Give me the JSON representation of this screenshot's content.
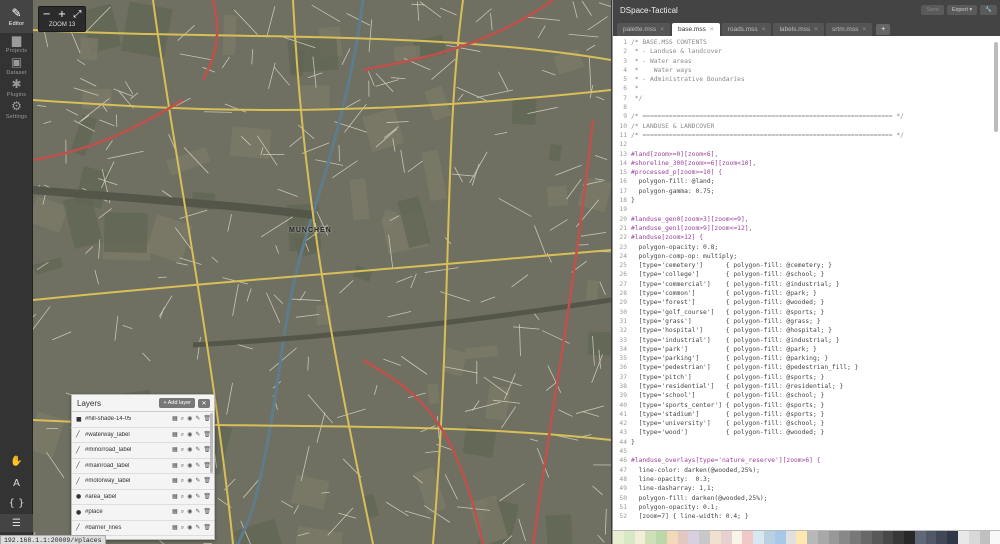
{
  "toolbar": {
    "items": [
      {
        "label": "Editor",
        "icon": "pencil-icon",
        "glyph": "✎",
        "active": true
      },
      {
        "label": "Projects",
        "icon": "folder-icon",
        "glyph": "▆",
        "active": false
      },
      {
        "label": "Dataset",
        "icon": "dataset-icon",
        "glyph": "▣",
        "active": false
      },
      {
        "label": "Plugins",
        "icon": "plugin-icon",
        "glyph": "✱",
        "active": false
      },
      {
        "label": "Settings",
        "icon": "gear-icon",
        "glyph": "⚙",
        "active": false
      }
    ],
    "bottom": [
      {
        "name": "hand-icon",
        "glyph": "✋"
      },
      {
        "name": "font-icon",
        "glyph": "A"
      },
      {
        "name": "braces-icon",
        "glyph": "{ }"
      },
      {
        "name": "layers-icon",
        "glyph": "☰"
      }
    ]
  },
  "map": {
    "zoom_in": "+",
    "zoom_out": "−",
    "fullscreen": "⤢",
    "zoom_label": "ZOOM 13",
    "city_label": "MÜNCHEN",
    "status_url": "192.168.1.1:20009/#places"
  },
  "layers_panel": {
    "title": "Layers",
    "add_label": "+ Add layer",
    "close_label": "✕",
    "rows": [
      {
        "type_glyph": "■",
        "name": "#hill-shade-14-05"
      },
      {
        "type_glyph": "╱",
        "name": "#waterway_label"
      },
      {
        "type_glyph": "╱",
        "name": "#minorroad_label"
      },
      {
        "type_glyph": "╱",
        "name": "#mainroad_label"
      },
      {
        "type_glyph": "╱",
        "name": "#motorway_label"
      },
      {
        "type_glyph": "●",
        "name": "#area_label"
      },
      {
        "type_glyph": "●",
        "name": "#place"
      },
      {
        "type_glyph": "╱",
        "name": "#barrier_lines"
      }
    ],
    "action_glyphs": [
      "▦",
      "⌕",
      "◉",
      "✎",
      "🗑"
    ]
  },
  "editor": {
    "project_title": "DSpace-Tactical",
    "save_label": "Save",
    "export_label": "Export ▾",
    "wrench_label": "🔧",
    "tabs": [
      {
        "label": "palette.mss",
        "active": false
      },
      {
        "label": "base.mss",
        "active": true
      },
      {
        "label": "roads.mss",
        "active": false
      },
      {
        "label": "labels.mss",
        "active": false
      },
      {
        "label": "srtm.mss",
        "active": false
      }
    ],
    "tab_close": "×",
    "add_tab": "+",
    "code_lines": [
      {
        "n": "1",
        "t": "/* BASE.MSS CONTENTS",
        "c": "comment"
      },
      {
        "n": "2",
        "t": " * - Landuse & landcover",
        "c": "comment"
      },
      {
        "n": "3",
        "t": " * - Water areas",
        "c": "comment"
      },
      {
        "n": "4",
        "t": " *    Water ways",
        "c": "comment"
      },
      {
        "n": "5",
        "t": " * - Administrative Boundaries",
        "c": "comment"
      },
      {
        "n": "6",
        "t": " *",
        "c": "comment"
      },
      {
        "n": "7",
        "t": " */",
        "c": "comment"
      },
      {
        "n": "8",
        "t": "",
        "c": "plain"
      },
      {
        "n": "9",
        "t": "/* ================================================================== */",
        "c": "comment"
      },
      {
        "n": "10",
        "t": "/* LANDUSE & LANDCOVER",
        "c": "comment"
      },
      {
        "n": "11",
        "t": "/* ================================================================== */",
        "c": "comment"
      },
      {
        "n": "12",
        "t": "",
        "c": "plain"
      },
      {
        "n": "13",
        "t": "#land[zoom>=0][zoom<6],",
        "c": "sel"
      },
      {
        "n": "14",
        "t": "#shoreline_300[zoom>=6][zoom<10],",
        "c": "sel"
      },
      {
        "n": "15",
        "t": "#processed_p[zoom>=10] {",
        "c": "sel"
      },
      {
        "n": "16",
        "t": "  polygon-fill: @land;",
        "c": "prop"
      },
      {
        "n": "17",
        "t": "  polygon-gamma: 0.75;",
        "c": "prop"
      },
      {
        "n": "18",
        "t": "}",
        "c": "plain"
      },
      {
        "n": "19",
        "t": "",
        "c": "plain"
      },
      {
        "n": "20",
        "t": "#landuse_gen0[zoom>3][zoom<=9],",
        "c": "sel"
      },
      {
        "n": "21",
        "t": "#landuse_gen1[zoom>9][zoom<=12],",
        "c": "sel"
      },
      {
        "n": "22",
        "t": "#landuse[zoom>12] {",
        "c": "sel"
      },
      {
        "n": "23",
        "t": "  polygon-opacity: 0.8;",
        "c": "prop"
      },
      {
        "n": "24",
        "t": "  polygon-comp-op: multiply;",
        "c": "prop"
      },
      {
        "n": "25",
        "t": "  [type='cemetery']      { polygon-fill: @cemetery; }",
        "c": "prop"
      },
      {
        "n": "26",
        "t": "  [type='college']       { polygon-fill: @school; }",
        "c": "prop"
      },
      {
        "n": "27",
        "t": "  [type='commercial']    { polygon-fill: @industrial; }",
        "c": "prop"
      },
      {
        "n": "28",
        "t": "  [type='common']        { polygon-fill: @park; }",
        "c": "prop"
      },
      {
        "n": "29",
        "t": "  [type='forest']        { polygon-fill: @wooded; }",
        "c": "prop"
      },
      {
        "n": "30",
        "t": "  [type='golf_course']   { polygon-fill: @sports; }",
        "c": "prop"
      },
      {
        "n": "31",
        "t": "  [type='grass']         { polygon-fill: @grass; }",
        "c": "prop"
      },
      {
        "n": "32",
        "t": "  [type='hospital']      { polygon-fill: @hospital; }",
        "c": "prop"
      },
      {
        "n": "33",
        "t": "  [type='industrial']    { polygon-fill: @industrial; }",
        "c": "prop"
      },
      {
        "n": "34",
        "t": "  [type='park']          { polygon-fill: @park; }",
        "c": "prop"
      },
      {
        "n": "35",
        "t": "  [type='parking']       { polygon-fill: @parking; }",
        "c": "prop"
      },
      {
        "n": "36",
        "t": "  [type='pedestrian']    { polygon-fill: @pedestrian_fill; }",
        "c": "prop"
      },
      {
        "n": "37",
        "t": "  [type='pitch']         { polygon-fill: @sports; }",
        "c": "prop"
      },
      {
        "n": "38",
        "t": "  [type='residential']   { polygon-fill: @residential; }",
        "c": "prop"
      },
      {
        "n": "39",
        "t": "  [type='school']        { polygon-fill: @school; }",
        "c": "prop"
      },
      {
        "n": "40",
        "t": "  [type='sports_center'] { polygon-fill: @sports; }",
        "c": "prop"
      },
      {
        "n": "41",
        "t": "  [type='stadium']       { polygon-fill: @sports; }",
        "c": "prop"
      },
      {
        "n": "42",
        "t": "  [type='university']    { polygon-fill: @school; }",
        "c": "prop"
      },
      {
        "n": "43",
        "t": "  [type='wood']          { polygon-fill: @wooded; }",
        "c": "prop"
      },
      {
        "n": "44",
        "t": "}",
        "c": "plain"
      },
      {
        "n": "45",
        "t": "",
        "c": "plain"
      },
      {
        "n": "46",
        "t": "#landuse_overlays[type='nature_reserve'][zoom>6] {",
        "c": "sel"
      },
      {
        "n": "47",
        "t": "  line-color: darken(@wooded,25%);",
        "c": "prop"
      },
      {
        "n": "48",
        "t": "  line-opacity:  0.3;",
        "c": "prop"
      },
      {
        "n": "49",
        "t": "  line-dasharray: 1,1;",
        "c": "prop"
      },
      {
        "n": "50",
        "t": "  polygon-fill: darken(@wooded,25%);",
        "c": "prop"
      },
      {
        "n": "51",
        "t": "  polygon-opacity: 0.1;",
        "c": "prop"
      },
      {
        "n": "52",
        "t": "  [zoom=7] { line-width: 0.4; }",
        "c": "prop"
      }
    ],
    "palette": [
      "#e8eed0",
      "#d9e8c4",
      "#f2eed8",
      "#cfe0b8",
      "#bcd8a8",
      "#f4d9b8",
      "#e2c8c0",
      "#d8d0e0",
      "#c8c8c8",
      "#f0e0d0",
      "#e8d0d0",
      "#f8f4e8",
      "#f0c8c8",
      "#d8e8f0",
      "#b8d0e0",
      "#a8c8e8",
      "#e0e0e0",
      "#ffe8b0",
      "#b8b8b8",
      "#a8a8a8",
      "#989898",
      "#888888",
      "#787878",
      "#686868",
      "#585858",
      "#484848",
      "#383838",
      "#282828",
      "#606878",
      "#505868",
      "#404858",
      "#303848",
      "#e8e8e8",
      "#d8d8d8",
      "#c0c0c0",
      "#f8f8f8"
    ]
  }
}
